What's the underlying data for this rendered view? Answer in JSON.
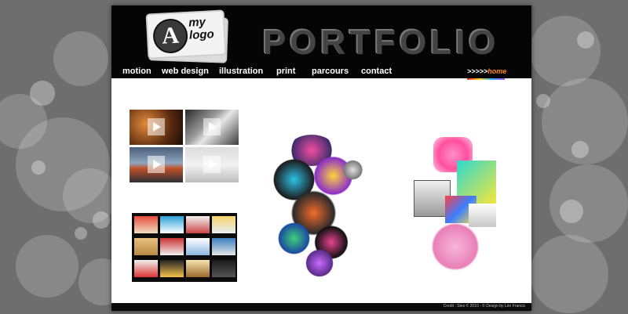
{
  "header": {
    "logo_top": "my",
    "logo_bottom": "logo",
    "logo_letter": "A",
    "title": "PORTFOLIO"
  },
  "nav": {
    "items": [
      {
        "label": "motion"
      },
      {
        "label": "web design"
      },
      {
        "label": "illustration"
      },
      {
        "label": "print"
      },
      {
        "label": "parcours"
      },
      {
        "label": "contact"
      }
    ],
    "home_arrows": ">>>>>",
    "home_label": "home"
  },
  "footer": {
    "credit": "Credit : Stes © 2010 - © Design by Léo Francis"
  },
  "colors": {
    "background": "#6e6e6e",
    "header": "#050505",
    "page": "#ffffff",
    "home_accent": "#ff8c1a"
  },
  "icons": {
    "play": "play-icon"
  }
}
